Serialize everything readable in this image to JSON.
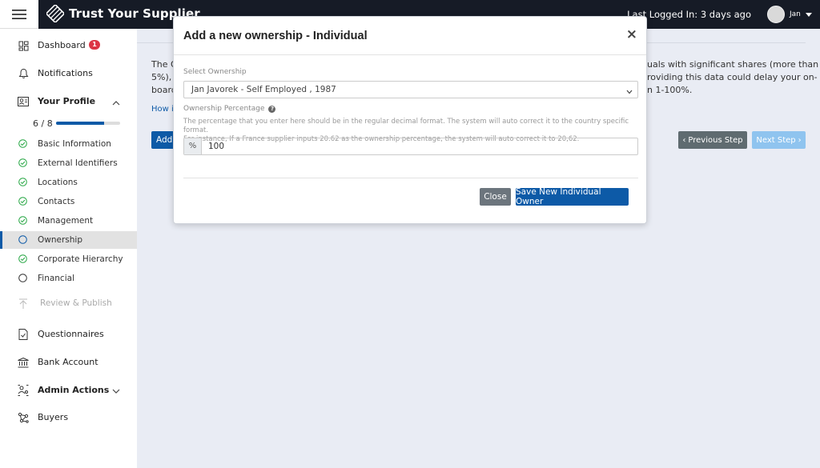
{
  "app": {
    "brand": "Trust Your Supplier",
    "last_logged_in": "Last Logged In: 3 days ago",
    "user_name": "Jan"
  },
  "sidebar": {
    "dashboard": {
      "label": "Dashboard",
      "badge": "1",
      "icon": "dashboard-icon"
    },
    "notifications": {
      "label": "Notifications",
      "icon": "bell-icon"
    },
    "your_profile": {
      "label": "Your Profile",
      "icon": "profile-card-icon"
    },
    "progress": {
      "text": "6 / 8",
      "completed": 6,
      "total": 8
    },
    "profile_steps": [
      {
        "label": "Basic Information",
        "status": "done"
      },
      {
        "label": "External Identifiers",
        "status": "done"
      },
      {
        "label": "Locations",
        "status": "done"
      },
      {
        "label": "Contacts",
        "status": "done"
      },
      {
        "label": "Management",
        "status": "done"
      },
      {
        "label": "Ownership",
        "status": "active"
      },
      {
        "label": "Corporate Hierarchy",
        "status": "done"
      },
      {
        "label": "Financial",
        "status": "pending"
      }
    ],
    "review_publish": {
      "label": "Review & Publish",
      "icon": "upload-arrow-icon"
    },
    "questionnaires": {
      "label": "Questionnaires",
      "icon": "document-check-icon"
    },
    "bank_account": {
      "label": "Bank Account",
      "icon": "bank-icon"
    },
    "admin_actions": {
      "label": "Admin Actions",
      "icon": "admin-users-icon"
    },
    "buyers": {
      "label": "Buyers",
      "icon": "network-icon"
    }
  },
  "background": {
    "line1_left": "The O",
    "line1_right": "uals with significant shares (more than",
    "line2_left": "5%), E",
    "line2_right": "roviding this data could delay your on-",
    "line3_left": "board",
    "line3_right": "n 1-100%.",
    "link": "How is",
    "add_button": "Add",
    "prev_button": "Previous Step",
    "next_button": "Next Step"
  },
  "modal": {
    "title": "Add a new ownership - Individual",
    "close_symbol": "×",
    "select_label": "Select Ownership",
    "select_value": "Jan Javorek - Self Employed , 1987",
    "percentage_label": "Ownership Percentage",
    "help_text_1": "The percentage that you enter here should be in the regular decimal format. The system will auto correct it to the country specific format.",
    "help_text_2": "For instance, If a France supplier inputs 20.62 as the ownership percentage, the system will auto correct it to 20,62.",
    "percent_addon": "%",
    "percentage_value": "100",
    "close_button": "Close",
    "save_button": "Save New Individual Owner"
  },
  "colors": {
    "topbar": "#161b26",
    "primary": "#0d5aa7",
    "success": "#28a745",
    "badge": "#dc3545"
  }
}
